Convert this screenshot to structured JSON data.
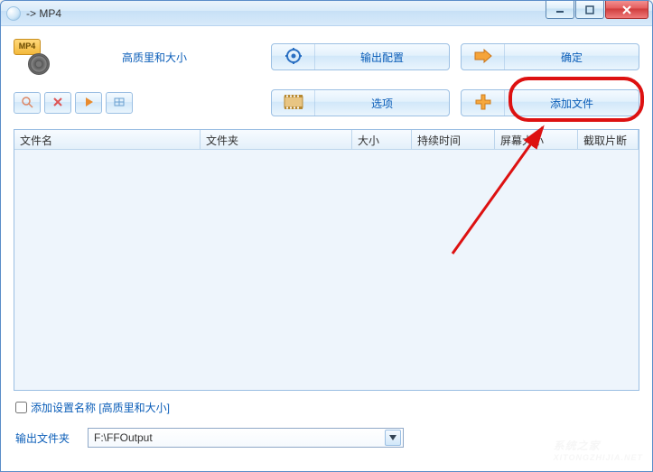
{
  "window": {
    "title": "-> MP4",
    "format_badge": "MP4"
  },
  "toolbar": {
    "profile_label": "高质里和大小",
    "output_config_label": "输出配置",
    "ok_label": "确定",
    "options_label": "选项",
    "add_file_label": "添加文件"
  },
  "columns": {
    "filename": "文件名",
    "folder": "文件夹",
    "size": "大小",
    "duration": "持续时间",
    "screen_size": "屏幕大小",
    "clip": "截取片断"
  },
  "bottom": {
    "checkbox_label": "添加设置名称 [高质里和大小]",
    "output_folder_label": "输出文件夹",
    "output_folder_value": "F:\\FFOutput"
  },
  "watermark": {
    "line1": "系统之家",
    "line2": "XITONGZHIJIA.NET"
  }
}
